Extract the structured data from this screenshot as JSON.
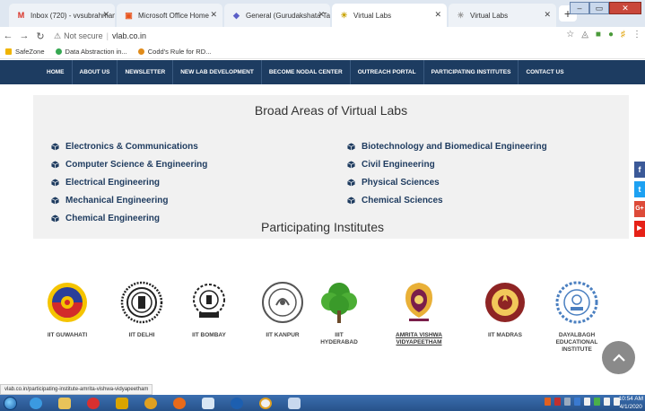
{
  "browser": {
    "tabs": [
      {
        "title": "Inbox (720) - vvsubrahmany...",
        "icon": "gmail-icon",
        "color": "#d93025"
      },
      {
        "title": "Microsoft Office Home",
        "icon": "office-icon",
        "color": "#e8541d"
      },
      {
        "title": "General (Gurudakshata Task...",
        "icon": "teams-icon",
        "color": "#5b5fc7"
      },
      {
        "title": "Virtual Labs",
        "icon": "vlab-icon",
        "color": "#c8a200"
      },
      {
        "title": "Virtual Labs",
        "icon": "vlab-icon",
        "color": "#b0b0b0"
      }
    ],
    "new_tab": "+",
    "url": {
      "security_label": "Not secure",
      "address": "vlab.co.in"
    },
    "bookmarks": [
      {
        "label": "SafeZone",
        "color": "#f0b400"
      },
      {
        "label": "Data Abstraction in...",
        "color": "#36a852"
      },
      {
        "label": "Codd's Rule for RD...",
        "color": "#e08b1a"
      }
    ],
    "status_url": "vlab.co.in/participating-institute-amrita-vishwa-vidyapeetham"
  },
  "site_nav": [
    "HOME",
    "ABOUT US",
    "NEWSLETTER",
    "NEW LAB DEVELOPMENT",
    "BECOME NODAL CENTER",
    "OUTREACH PORTAL",
    "PARTICIPATING INSTITUTES",
    "CONTACT US"
  ],
  "broad_areas": {
    "title": "Broad Areas of Virtual Labs",
    "left": [
      "Electronics & Communications",
      "Computer Science & Engineering",
      "Electrical Engineering",
      "Mechanical Engineering",
      "Chemical Engineering"
    ],
    "right": [
      "Biotechnology and Biomedical Engineering",
      "Civil Engineering",
      "Physical Sciences",
      "Chemical Sciences"
    ]
  },
  "participating": {
    "title": "Participating Institutes",
    "institutes": [
      {
        "name": "IIT GUWAHATI",
        "logo": "iit-guwahati-logo"
      },
      {
        "name": "IIT DELHI",
        "logo": "iit-delhi-logo"
      },
      {
        "name": "IIT BOMBAY",
        "logo": "iit-bombay-logo"
      },
      {
        "name": "IIT KANPUR",
        "logo": "iit-kanpur-logo"
      },
      {
        "name": "IIIT HYDERABAD",
        "logo": "iiit-hyderabad-logo"
      },
      {
        "name": "AMRITA VISHWA VIDYAPEETHAM",
        "logo": "amrita-logo"
      },
      {
        "name": "IIT MADRAS",
        "logo": "iit-madras-logo"
      },
      {
        "name": "DAYALBAGH EDUCATIONAL INSTITUTE",
        "logo": "dayalbagh-logo"
      }
    ]
  },
  "social": [
    {
      "label": "f",
      "icon": "facebook-icon",
      "color": "#3b5998"
    },
    {
      "label": "t",
      "icon": "twitter-icon",
      "color": "#1da1f2"
    },
    {
      "label": "G+",
      "icon": "google-plus-icon",
      "color": "#dd4b39"
    },
    {
      "label": "▶",
      "icon": "youtube-icon",
      "color": "#e62117"
    }
  ],
  "taskbar": {
    "time": "10:54 AM",
    "date": "4/1/2020"
  },
  "colors": {
    "nav_bg": "#1d3c61",
    "link": "#1e3b5f",
    "section_bg": "#f1f1f1"
  }
}
